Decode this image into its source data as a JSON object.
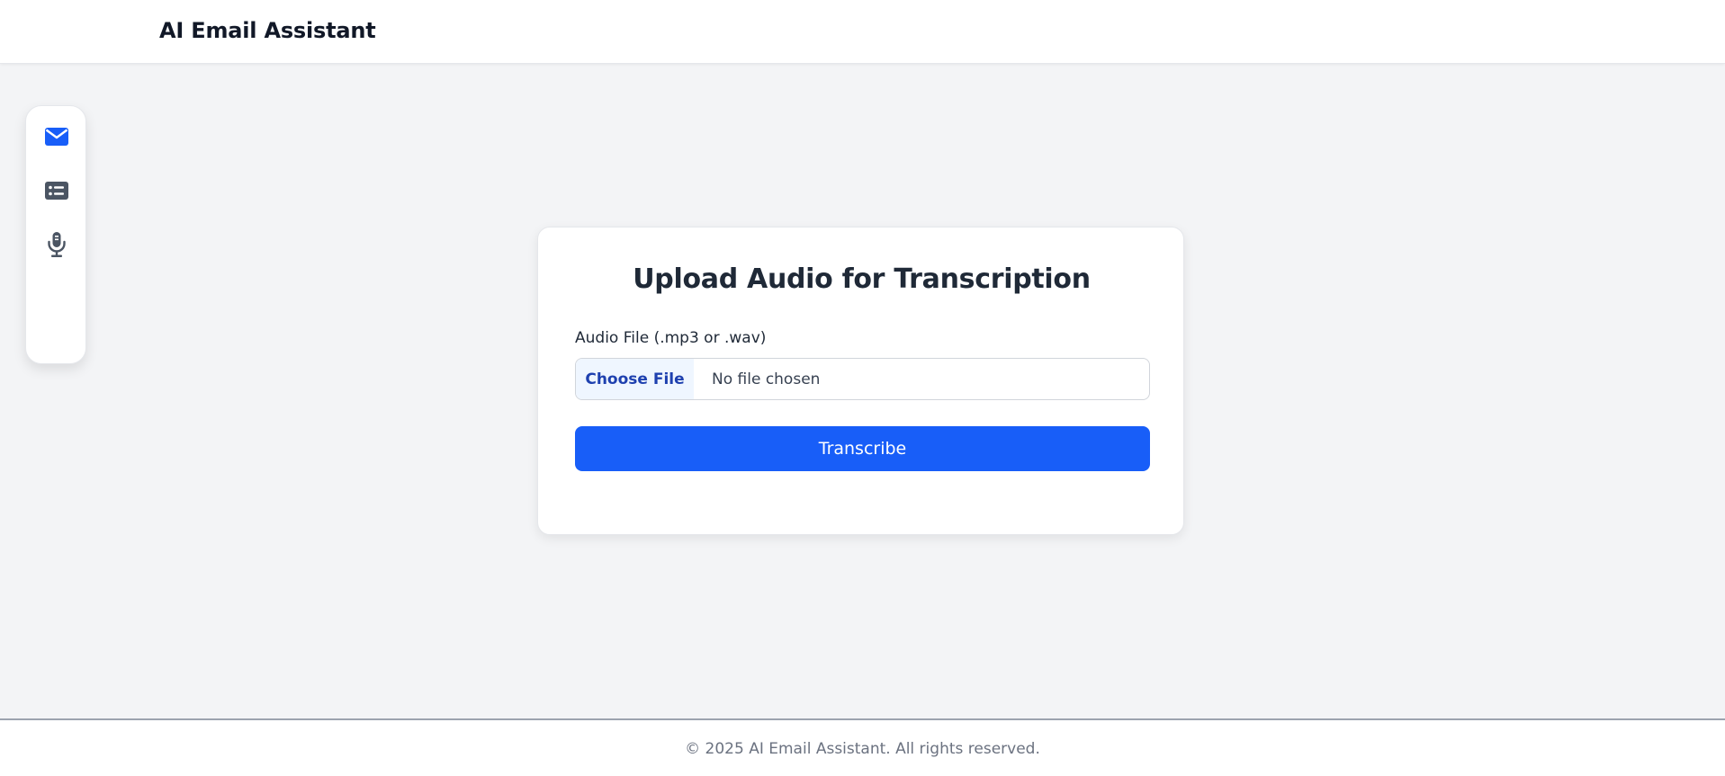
{
  "header": {
    "title": "AI Email Assistant"
  },
  "sidebar": {
    "items": [
      {
        "icon": "envelope-icon",
        "active": true
      },
      {
        "icon": "list-card-icon",
        "active": false
      },
      {
        "icon": "microphone-icon",
        "active": false
      }
    ]
  },
  "card": {
    "title": "Upload Audio for Transcription",
    "field_label": "Audio File (.mp3 or .wav)",
    "file_button_label": "Choose File",
    "file_status": "No file chosen",
    "submit_label": "Transcribe"
  },
  "footer": {
    "text": "© 2025 AI Email Assistant. All rights reserved."
  },
  "colors": {
    "accent": "#185ef8",
    "page_bg": "#f3f4f6",
    "icon_inactive": "#4b5563"
  }
}
